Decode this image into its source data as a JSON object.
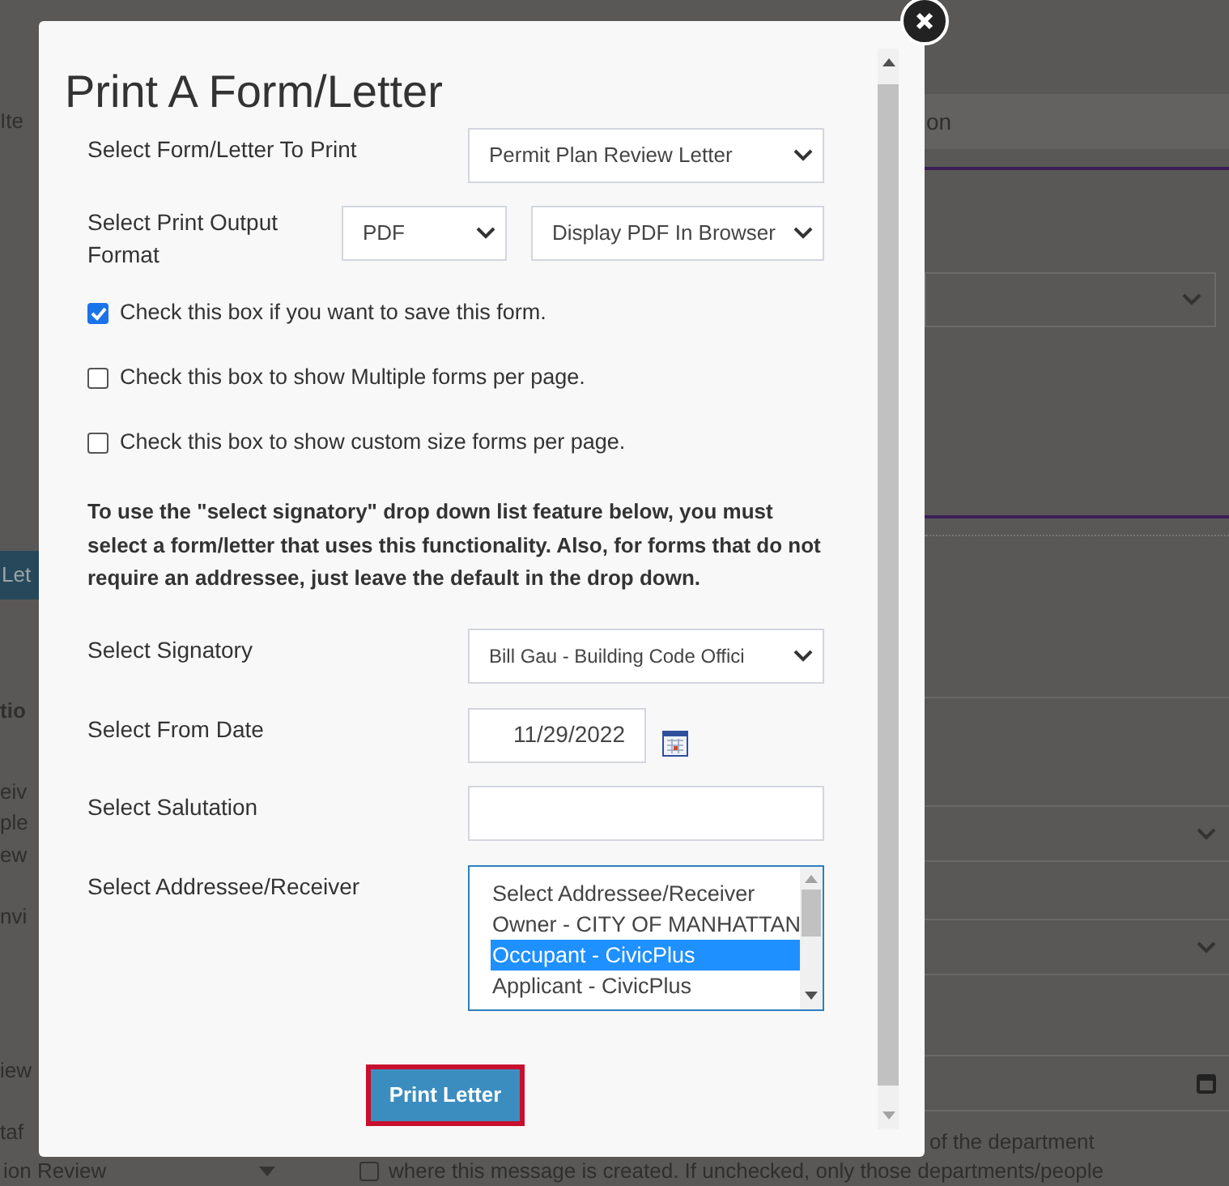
{
  "background": {
    "left_fragments": [
      {
        "text": "Ite",
        "bold": false,
        "kind": "text"
      },
      {
        "text": "Let",
        "bold": false,
        "kind": "button"
      },
      {
        "text": "tio",
        "bold": true,
        "kind": "text"
      },
      {
        "text": "eiv",
        "bold": false,
        "kind": "text"
      },
      {
        "text": "ple",
        "bold": false,
        "kind": "text"
      },
      {
        "text": "ew",
        "bold": false,
        "kind": "text"
      },
      {
        "text": "nvi",
        "bold": false,
        "kind": "text"
      },
      {
        "text": "iew",
        "bold": false,
        "kind": "text"
      },
      {
        "text": "taf",
        "bold": false,
        "kind": "text"
      }
    ],
    "tab_fragment": "on",
    "department_text": "of the department",
    "bottom_left_text": "ion Review",
    "notify_checkbox": {
      "checked": false,
      "label": "where this message is created. If unchecked, only those departments/people"
    }
  },
  "dialog": {
    "title": "Print A Form/Letter",
    "form_row": {
      "label": "Select Form/Letter To Print",
      "value": "Permit Plan Review Letter"
    },
    "output_format": {
      "label": "Select Print Output Format",
      "format": "PDF",
      "destination": "Display PDF In Browser"
    },
    "checkboxes": [
      {
        "label": "Check this box if you want to save this form.",
        "checked": true
      },
      {
        "label": "Check this box to show Multiple forms per page.",
        "checked": false
      },
      {
        "label": "Check this box to show custom size forms per page.",
        "checked": false
      }
    ],
    "note": "To use the \"select signatory\" drop down list feature below, you must select a form/letter that uses this functionality. Also, for forms that do not require an addressee, just leave the default in the drop down.",
    "signatory": {
      "label": "Select Signatory",
      "value": "Bill Gau - Building Code Offici"
    },
    "from_date": {
      "label": "Select From Date",
      "value": "11/29/2022"
    },
    "salutation": {
      "label": "Select Salutation"
    },
    "addressee": {
      "label": "Select Addressee/Receiver",
      "options": [
        {
          "label": "Select Addressee/Receiver",
          "selected": false
        },
        {
          "label": "Owner - CITY OF MANHATTAN",
          "selected": false
        },
        {
          "label": "Occupant - CivicPlus",
          "selected": true
        },
        {
          "label": "Applicant - CivicPlus",
          "selected": false
        }
      ]
    },
    "print_button": "Print Letter"
  }
}
